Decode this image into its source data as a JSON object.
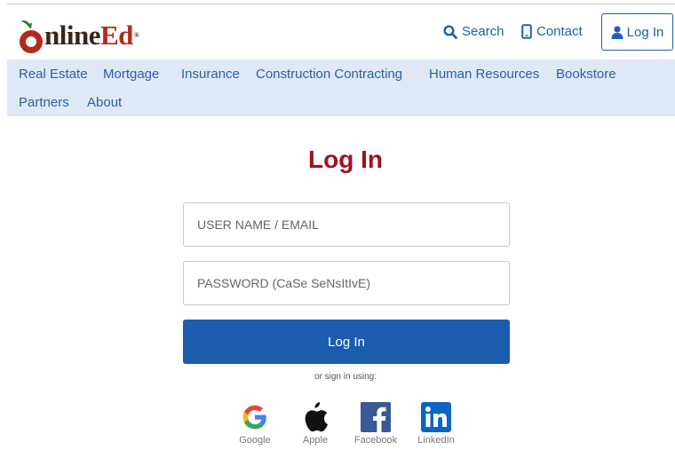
{
  "header": {
    "logo_main": "nline",
    "logo_accent": "Ed",
    "logo_reg": "®",
    "search_label": "Search",
    "contact_label": "Contact",
    "login_label": "Log In"
  },
  "nav": {
    "items": [
      "Real Estate",
      "Mortgage",
      "Insurance",
      "Construction Contracting",
      "Human Resources",
      "Bookstore",
      "Partners",
      "About"
    ]
  },
  "form": {
    "title": "Log In",
    "username_placeholder": "USER NAME / EMAIL",
    "password_placeholder": "PASSWORD (CaSe SeNsItIvE)",
    "submit_label": "Log In",
    "or_text": "or sign in using:"
  },
  "social": [
    {
      "label": "Google",
      "icon": "google-icon"
    },
    {
      "label": "Apple",
      "icon": "apple-icon"
    },
    {
      "label": "Facebook",
      "icon": "facebook-icon"
    },
    {
      "label": "LinkedIn",
      "icon": "linkedin-icon"
    }
  ],
  "colors": {
    "brand_blue": "#1c5cae",
    "title_red": "#a0121d",
    "nav_bg": "#dfe9f6"
  }
}
